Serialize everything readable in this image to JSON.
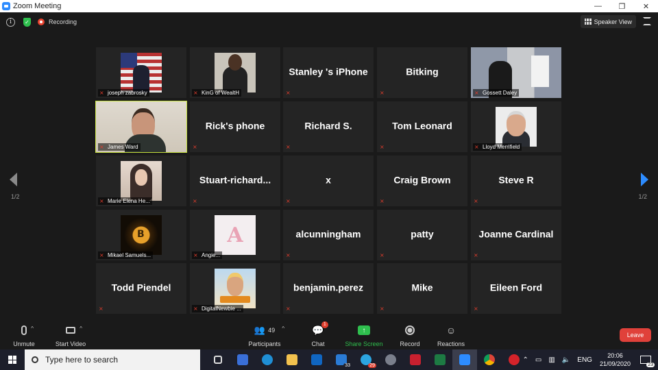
{
  "window": {
    "title": "Zoom Meeting",
    "controls": [
      "—",
      "❐",
      "✕"
    ]
  },
  "topbar": {
    "recording_label": "Recording",
    "speaker_view_label": "Speaker View"
  },
  "pages": {
    "left": "1/2",
    "right": "1/2"
  },
  "participants": [
    {
      "name": "joseph zabrosky",
      "photo": "flag"
    },
    {
      "name": "KinG of WealtH",
      "photo": "suit"
    },
    {
      "name": "Stanley 's iPhone",
      "photo": null
    },
    {
      "name": "Bitking",
      "photo": null
    },
    {
      "name": "Gossett Daley",
      "photo": "room"
    },
    {
      "name": "James Ward",
      "photo": "james",
      "active": true
    },
    {
      "name": "Rick's phone",
      "photo": null
    },
    {
      "name": "Richard S.",
      "photo": null
    },
    {
      "name": "Tom Leonard",
      "photo": null
    },
    {
      "name": "Lloyd Merrifield",
      "photo": "lloyd"
    },
    {
      "name": "Marie Elena He...",
      "photo": "marie"
    },
    {
      "name": "Stuart-richard...",
      "photo": null
    },
    {
      "name": "x",
      "photo": null
    },
    {
      "name": "Craig Brown",
      "photo": null
    },
    {
      "name": "Steve R",
      "photo": null
    },
    {
      "name": "Mikael Samuels...",
      "photo": "bitcoin"
    },
    {
      "name": "Angie...",
      "photo": "avatar-a",
      "photo_text": "A"
    },
    {
      "name": "alcunningham",
      "photo": null
    },
    {
      "name": "patty",
      "photo": null
    },
    {
      "name": "Joanne Cardinal",
      "photo": null
    },
    {
      "name": "Todd Piendel",
      "photo": null
    },
    {
      "name": "DigitalNewbie ...",
      "photo": "digital"
    },
    {
      "name": "benjamin.perez",
      "photo": null
    },
    {
      "name": "Mike",
      "photo": null
    },
    {
      "name": "Eileen Ford",
      "photo": null
    }
  ],
  "toolbar": {
    "unmute_label": "Unmute",
    "start_video_label": "Start Video",
    "participants_label": "Participants",
    "participants_count": "49",
    "chat_label": "Chat",
    "chat_badge": "1",
    "share_screen_label": "Share Screen",
    "record_label": "Record",
    "reactions_label": "Reactions",
    "leave_label": "Leave"
  },
  "taskbar": {
    "search_placeholder": "Type here to search",
    "mail_badge": "33",
    "telegram_badge": "29",
    "language": "ENG",
    "time": "20:06",
    "date": "21/09/2020",
    "notification_count": "23"
  },
  "colors": {
    "active_speaker": "#c5e03c",
    "zoom_blue": "#2d8cff",
    "leave_red": "#e0413a",
    "share_green": "#2fbf4e"
  }
}
